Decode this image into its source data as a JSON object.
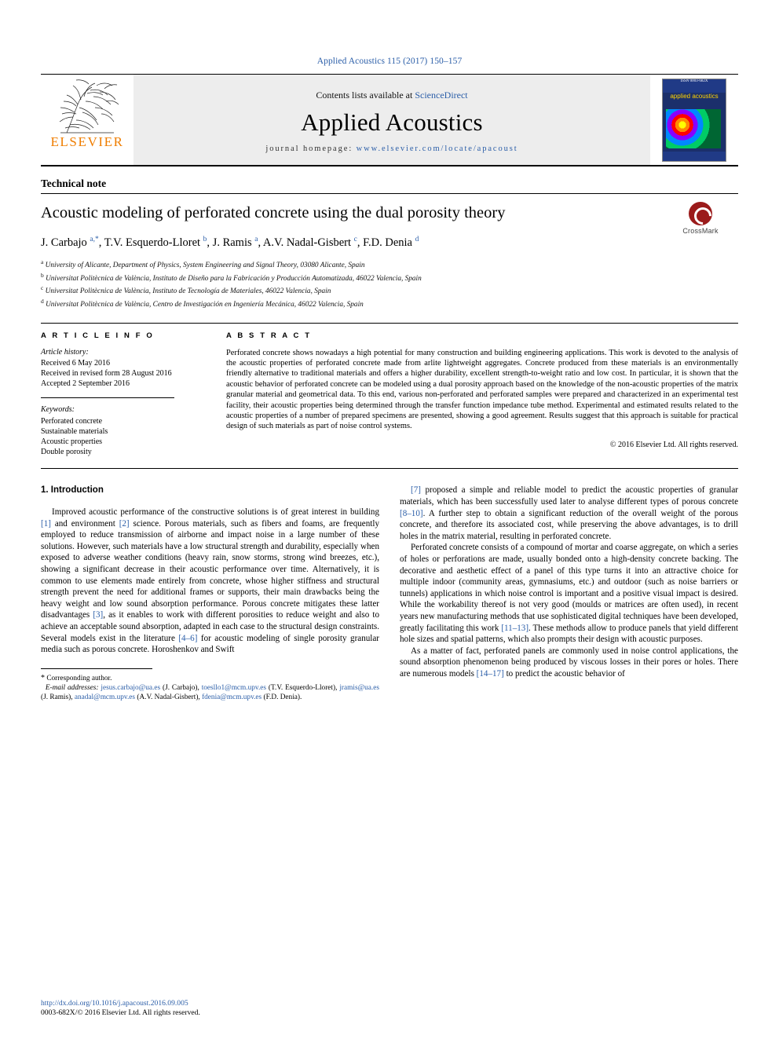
{
  "header": {
    "journal_ref": "Applied Acoustics 115 (2017) 150–157"
  },
  "masthead": {
    "publisher": "ELSEVIER",
    "contents_prefix": "Contents lists available at ",
    "contents_link": "ScienceDirect",
    "journal_title": "Applied Acoustics",
    "homepage_prefix": "journal homepage: ",
    "homepage_url": "www.elsevier.com/locate/apacoust",
    "cover_top": "ISSN 0003-682X",
    "cover_title": "applied acoustics"
  },
  "article": {
    "type": "Technical note",
    "title": "Acoustic modeling of perforated concrete using the dual porosity theory",
    "crossmark_label": "CrossMark",
    "authors_html": "J. Carbajo <sup>a,*</sup>, T.V. Esquerdo-Lloret <sup>b</sup>, J. Ramis <sup>a</sup>, A.V. Nadal-Gisbert <sup>c</sup>, F.D. Denia <sup>d</sup>",
    "affiliations": [
      "University of Alicante, Department of Physics, System Engineering and Signal Theory, 03080 Alicante, Spain",
      "Universitat Politècnica de València, Instituto de Diseño para la Fabricación y Producción Automatizada, 46022 Valencia, Spain",
      "Universitat Politècnica de València, Instituto de Tecnología de Materiales, 46022 Valencia, Spain",
      "Universitat Politècnica de València, Centro de Investigación en Ingeniería Mecánica, 46022 Valencia, Spain"
    ],
    "affiliation_marks": [
      "a",
      "b",
      "c",
      "d"
    ]
  },
  "info": {
    "heading": "A R T I C L E   I N F O",
    "history_label": "Article history:",
    "history": [
      "Received 6 May 2016",
      "Received in revised form 28 August 2016",
      "Accepted 2 September 2016"
    ],
    "keywords_label": "Keywords:",
    "keywords": [
      "Perforated concrete",
      "Sustainable materials",
      "Acoustic properties",
      "Double porosity"
    ]
  },
  "abstract": {
    "heading": "A B S T R A C T",
    "text": "Perforated concrete shows nowadays a high potential for many construction and building engineering applications. This work is devoted to the analysis of the acoustic properties of perforated concrete made from arlite lightweight aggregates. Concrete produced from these materials is an environmentally friendly alternative to traditional materials and offers a higher durability, excellent strength-to-weight ratio and low cost. In particular, it is shown that the acoustic behavior of perforated concrete can be modeled using a dual porosity approach based on the knowledge of the non-acoustic properties of the matrix granular material and geometrical data. To this end, various non-perforated and perforated samples were prepared and characterized in an experimental test facility, their acoustic properties being determined through the transfer function impedance tube method. Experimental and estimated results related to the acoustic properties of a number of prepared specimens are presented, showing a good agreement. Results suggest that this approach is suitable for practical design of such materials as part of noise control systems.",
    "copyright": "© 2016 Elsevier Ltd. All rights reserved."
  },
  "body": {
    "section_title": "1. Introduction",
    "left_paragraphs": [
      "Improved acoustic performance of the constructive solutions is of great interest in building [1] and environment [2] science. Porous materials, such as fibers and foams, are frequently employed to reduce transmission of airborne and impact noise in a large number of these solutions. However, such materials have a low structural strength and durability, especially when exposed to adverse weather conditions (heavy rain, snow storms, strong wind breezes, etc.), showing a significant decrease in their acoustic performance over time. Alternatively, it is common to use elements made entirely from concrete, whose higher stiffness and structural strength prevent the need for additional frames or supports, their main drawbacks being the heavy weight and low sound absorption performance. Porous concrete mitigates these latter disadvantages [3], as it enables to work with different porosities to reduce weight and also to achieve an acceptable sound absorption, adapted in each case to the structural design constraints. Several models exist in the literature [4–6] for acoustic modeling of single porosity granular media such as porous concrete. Horoshenkov and Swift"
    ],
    "right_paragraphs": [
      "[7] proposed a simple and reliable model to predict the acoustic properties of granular materials, which has been successfully used later to analyse different types of porous concrete [8–10]. A further step to obtain a significant reduction of the overall weight of the porous concrete, and therefore its associated cost, while preserving the above advantages, is to drill holes in the matrix material, resulting in perforated concrete.",
      "Perforated concrete consists of a compound of mortar and coarse aggregate, on which a series of holes or perforations are made, usually bonded onto a high-density concrete backing. The decorative and aesthetic effect of a panel of this type turns it into an attractive choice for multiple indoor (community areas, gymnasiums, etc.) and outdoor (such as noise barriers or tunnels) applications in which noise control is important and a positive visual impact is desired. While the workability thereof is not very good (moulds or matrices are often used), in recent years new manufacturing methods that use sophisticated digital techniques have been developed, greatly facilitating this work [11–13]. These methods allow to produce panels that yield different hole sizes and spatial patterns, which also prompts their design with acoustic purposes.",
      "As a matter of fact, perforated panels are commonly used in noise control applications, the sound absorption phenomenon being produced by viscous losses in their pores or holes. There are numerous models [14–17] to predict the acoustic behavior of"
    ]
  },
  "footnote": {
    "corresponding_mark": "*",
    "corresponding_text": "Corresponding author.",
    "email_label": "E-mail addresses:",
    "emails": [
      {
        "address": "jesus.carbajo@ua.es",
        "name": "(J. Carbajo)"
      },
      {
        "address": "toesllo1@mcm.upv.es",
        "name": "(T.V. Esquerdo-Lloret)"
      },
      {
        "address": "jramis@ua.es",
        "name": "(J. Ramis)"
      },
      {
        "address": "anadal@mcm.upv.es",
        "name": "(A.V. Nadal-Gisbert)"
      },
      {
        "address": "fdenia@mcm.upv.es",
        "name": "(F.D. Denia)."
      }
    ]
  },
  "footer": {
    "doi": "http://dx.doi.org/10.1016/j.apacoust.2016.09.005",
    "issn_line": "0003-682X/© 2016 Elsevier Ltd. All rights reserved."
  },
  "colors": {
    "link": "#2b5ea8",
    "elsevier_orange": "#ef7d00",
    "crossmark_red": "#9b1b1b"
  }
}
